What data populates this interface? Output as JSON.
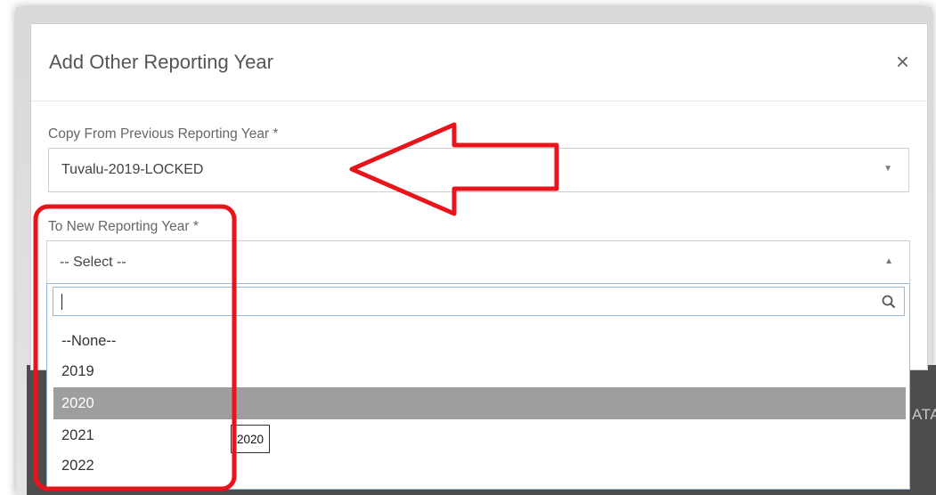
{
  "modal": {
    "title": "Add Other Reporting Year",
    "close_label": "×"
  },
  "copy_from": {
    "label": "Copy From Previous Reporting Year *",
    "value": "Tuvalu-2019-LOCKED"
  },
  "to_new": {
    "label": "To New Reporting Year *",
    "value": "-- Select --",
    "search_value": "",
    "options": [
      "--None--",
      "2019",
      "2020",
      "2021",
      "2022"
    ],
    "highlighted_option": "2020",
    "tooltip": "2020"
  },
  "backdrop": {
    "partial_text": "ATA"
  },
  "icons": {
    "close": "close-icon",
    "copy_caret": "caret-down-icon",
    "to_caret": "caret-up-icon",
    "search": "search-icon"
  },
  "annotation_color": "#e8141c"
}
